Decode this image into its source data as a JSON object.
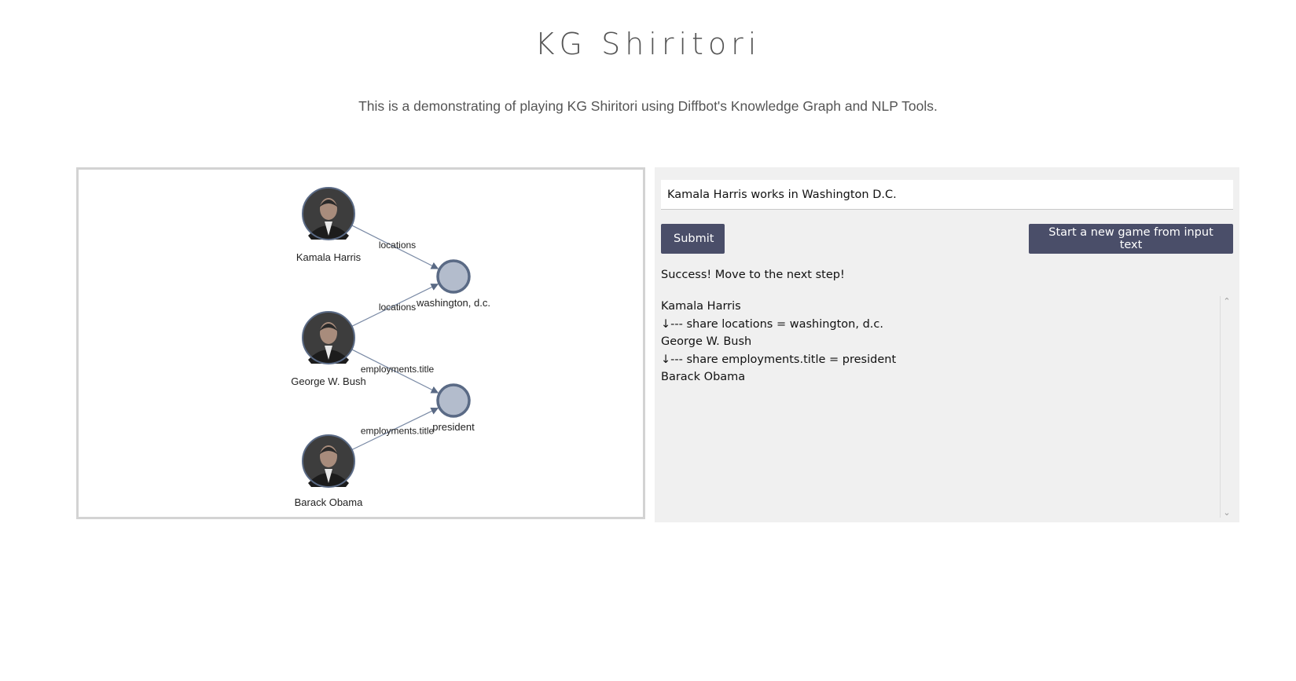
{
  "header": {
    "title": "KG Shiritori",
    "subtitle": "This is a demonstrating of playing KG Shiritori using Diffbot's Knowledge Graph and NLP Tools."
  },
  "graph": {
    "nodes": [
      {
        "id": "kamala",
        "label": "Kamala Harris",
        "kind": "person-photo"
      },
      {
        "id": "dc",
        "label": "washington, d.c.",
        "kind": "value"
      },
      {
        "id": "bush",
        "label": "George W. Bush",
        "kind": "person-photo"
      },
      {
        "id": "president",
        "label": "president",
        "kind": "value"
      },
      {
        "id": "obama",
        "label": "Barack Obama",
        "kind": "person-photo"
      }
    ],
    "edges": [
      {
        "from": "kamala",
        "to": "dc",
        "label": "locations"
      },
      {
        "from": "bush",
        "to": "dc",
        "label": "locations"
      },
      {
        "from": "bush",
        "to": "president",
        "label": "employments.title"
      },
      {
        "from": "obama",
        "to": "president",
        "label": "employments.title"
      }
    ],
    "colors": {
      "node_fill": "#b3bccc",
      "node_stroke": "#5a6a85",
      "edge": "#7a8aa5"
    }
  },
  "controls": {
    "input_value": "Kamala Harris works in Washington D.C.",
    "submit_label": "Submit",
    "new_game_label": "Start a new game from input text",
    "button_color": "#4a4e69"
  },
  "status": "Success! Move to the next step!",
  "chain": [
    "Kamala Harris",
    "↓--- share locations = washington, d.c.",
    "George W. Bush",
    "↓--- share employments.title = president",
    "Barack Obama"
  ]
}
